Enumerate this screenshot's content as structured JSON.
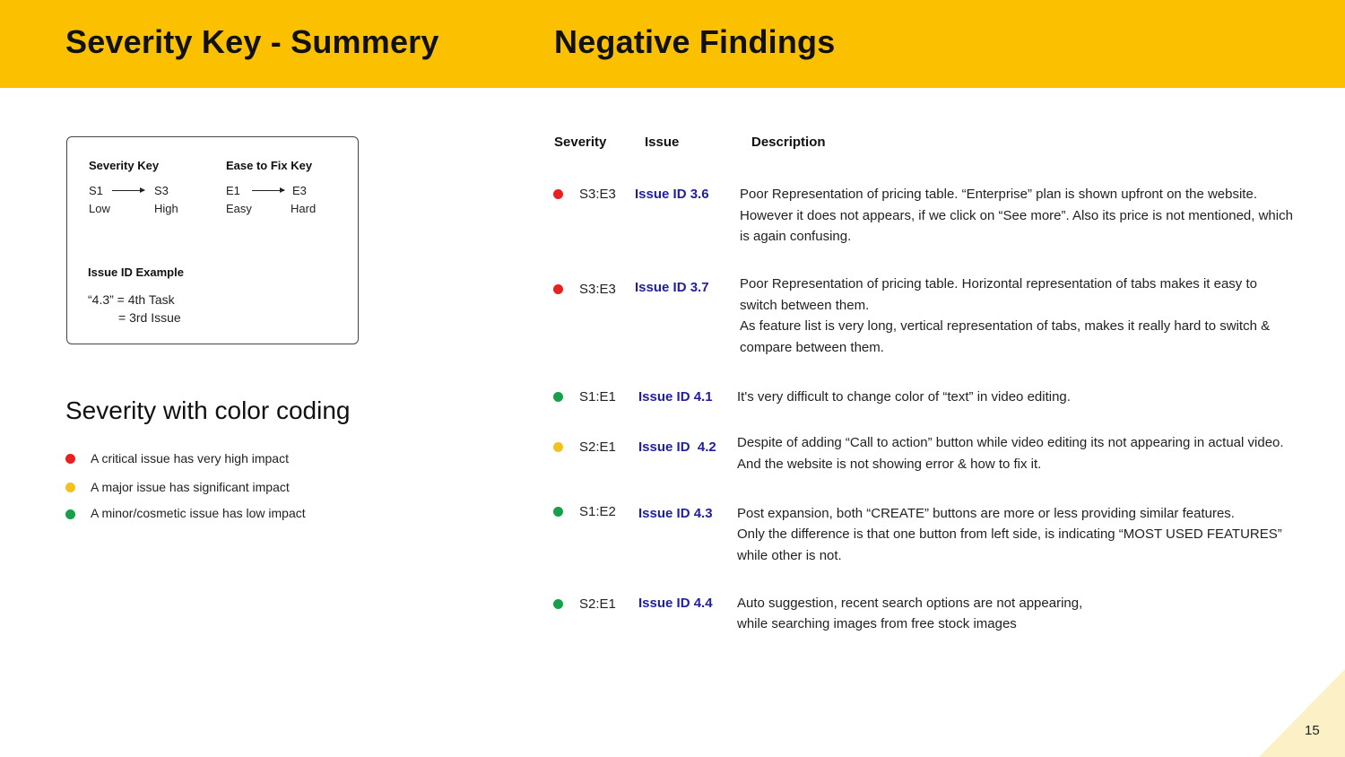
{
  "header": {
    "left_title": "Severity Key - Summery",
    "right_title": "Negative Findings",
    "color": "#fbc000"
  },
  "key_box": {
    "severity_key": {
      "title": "Severity Key",
      "from": "S1",
      "to": "S3",
      "from_label": "Low",
      "to_label": "High"
    },
    "ease_key": {
      "title": "Ease to Fix Key",
      "from": "E1",
      "to": "E3",
      "from_label": "Easy",
      "to_label": "Hard"
    },
    "issue_example": {
      "title": "Issue ID Example",
      "line1": "“4.3” = 4th Task",
      "line2": "= 3rd Issue"
    }
  },
  "color_coding": {
    "title": "Severity with color coding",
    "items": [
      {
        "text": "A critical issue has very high impact",
        "color": "#e8201f"
      },
      {
        "text": "A major issue has significant impact",
        "color": "#f2c21b"
      },
      {
        "text": "A minor/cosmetic issue has low impact",
        "color": "#17a04a"
      }
    ]
  },
  "findings": {
    "columns": {
      "severity": "Severity",
      "issue": "Issue",
      "description": "Description"
    },
    "rows": [
      {
        "color": "#e8201f",
        "severity": "S3:E3",
        "issue": "Issue ID 3.6",
        "description": "Poor Representation of pricing table. “Enterprise” plan is shown upfront on the website. However it does not appears, if we click on “See more”. Also its price is not mentioned, which is again confusing."
      },
      {
        "color": "#e8201f",
        "severity": "S3:E3",
        "issue": "Issue ID 3.7",
        "description_line1": "Poor Representation of pricing table.  Horizontal representation of tabs makes it easy to switch between them.",
        "description_line2": "As feature list is very long, vertical representation of tabs, makes it really hard to switch & compare between them."
      },
      {
        "color": "#17a04a",
        "severity": "S1:E1",
        "issue": "Issue ID 4.1",
        "description": "It's very difficult to change color of “text” in video editing."
      },
      {
        "color": "#f2c21b",
        "severity": "S2:E1",
        "issue": "Issue ID  4.2",
        "description": "Despite of adding “Call to action” button while video editing its not appearing in actual video. And the website is not showing error & how to fix it."
      },
      {
        "color": "#17a04a",
        "severity": "S1:E2",
        "issue": "Issue ID 4.3",
        "description_line1": "Post expansion, both “CREATE” buttons are more or less providing similar features.",
        "description_line2": "Only the difference is that one button from left side, is indicating “MOST USED FEATURES” while other is not."
      },
      {
        "color": "#17a04a",
        "severity": "S2:E1",
        "issue": "Issue ID 4.4",
        "description_line1": "Auto suggestion, recent search options are not appearing,",
        "description_line2": "while searching images from free stock images"
      }
    ]
  },
  "page_number": "15"
}
